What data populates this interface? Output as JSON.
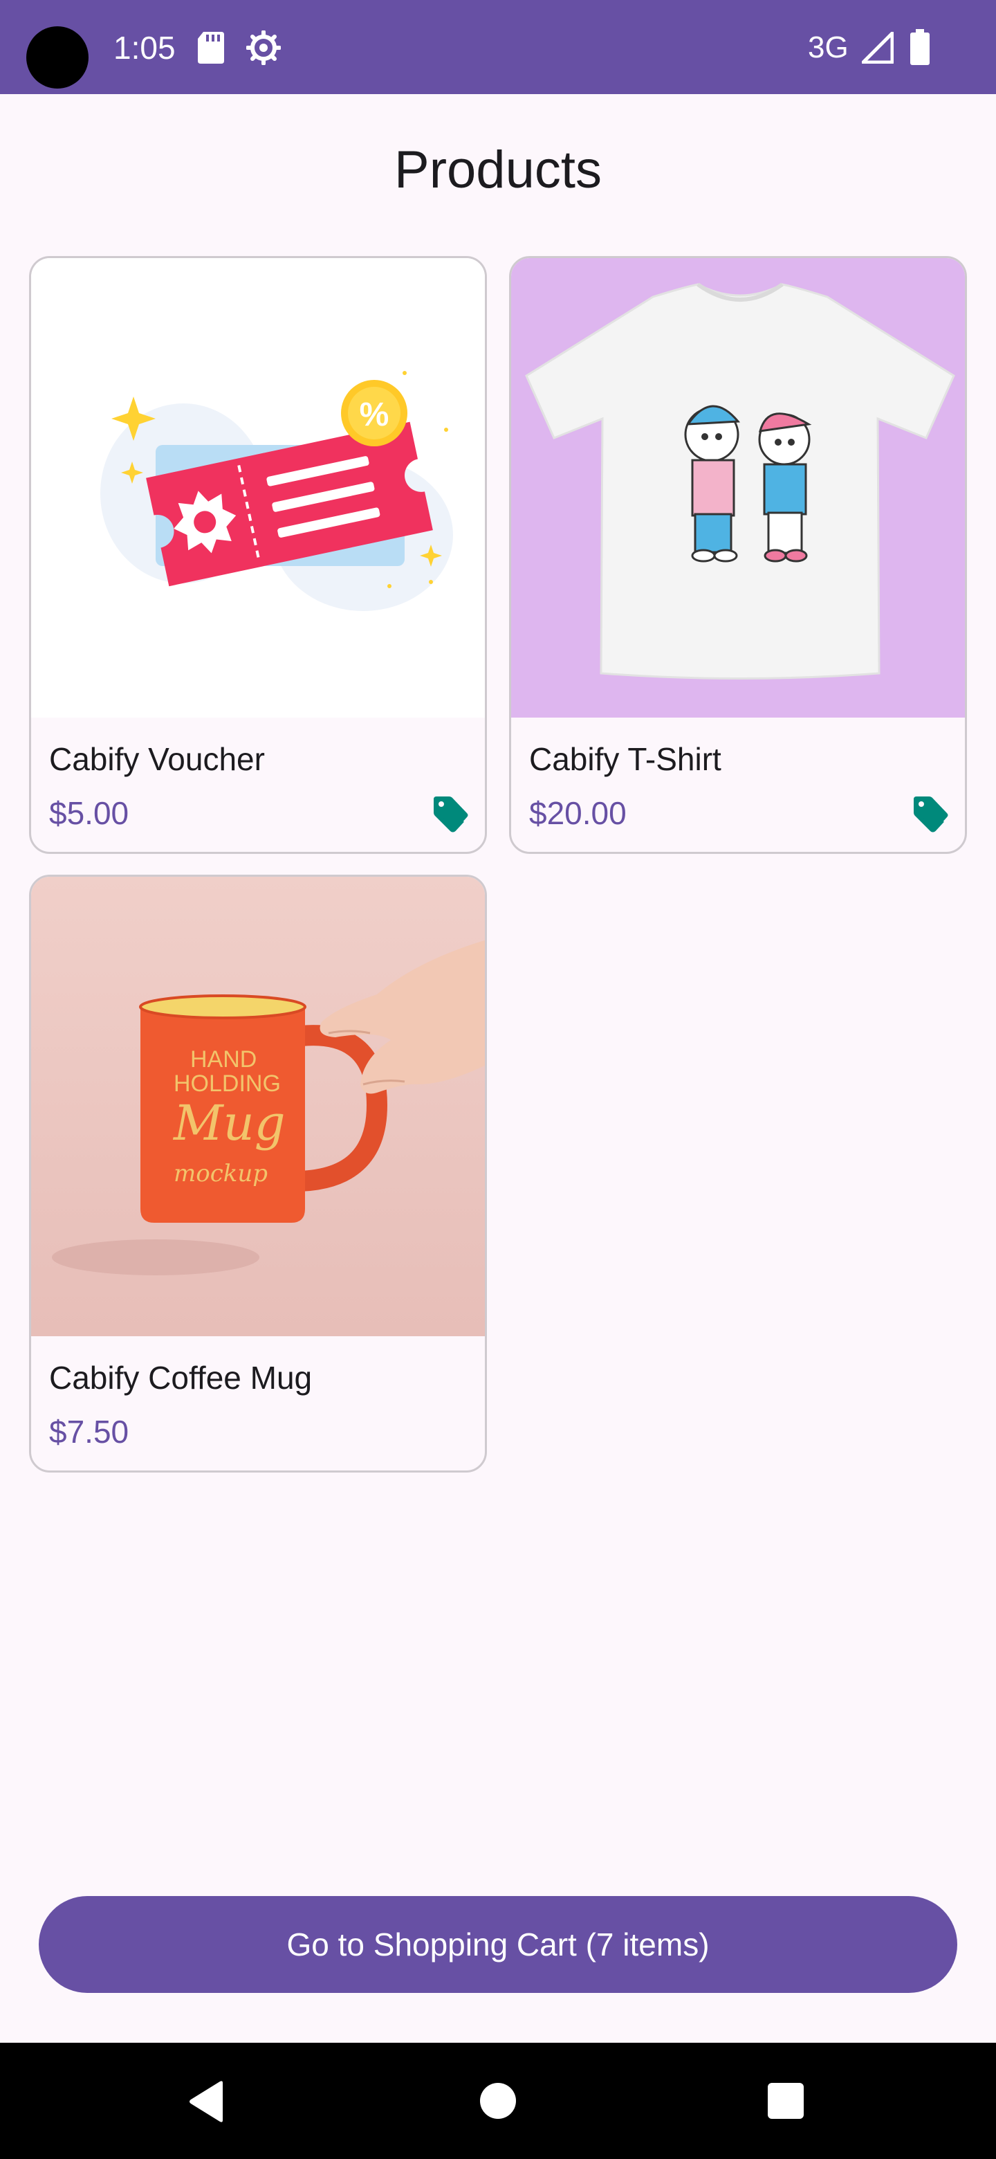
{
  "status_bar": {
    "time": "1:05",
    "network": "3G",
    "icons": [
      "sd-card-icon",
      "gear-icon",
      "signal-icon",
      "battery-icon"
    ]
  },
  "page": {
    "title": "Products"
  },
  "products": [
    {
      "name": "Cabify Voucher",
      "price": "$5.00",
      "image": "voucher-illustration",
      "discount_icon": "tag-icon"
    },
    {
      "name": "Cabify T-Shirt",
      "price": "$20.00",
      "image": "tshirt-photo",
      "discount_icon": "tag-icon"
    },
    {
      "name": "Cabify Coffee Mug",
      "price": "$7.50",
      "image": "mug-photo"
    }
  ],
  "mug_print": {
    "line1": "HAND",
    "line2": "HOLDING",
    "line3": "Mug",
    "line4": "mockup"
  },
  "cart_button": {
    "label": "Go to Shopping Cart (7 items)"
  },
  "nav_bar": {
    "icons": [
      "back-icon",
      "home-icon",
      "recents-icon"
    ]
  },
  "colors": {
    "primary": "#6750A4",
    "background": "#FDF7FC",
    "tag": "#00897B",
    "card_border": "#CFCACF"
  }
}
